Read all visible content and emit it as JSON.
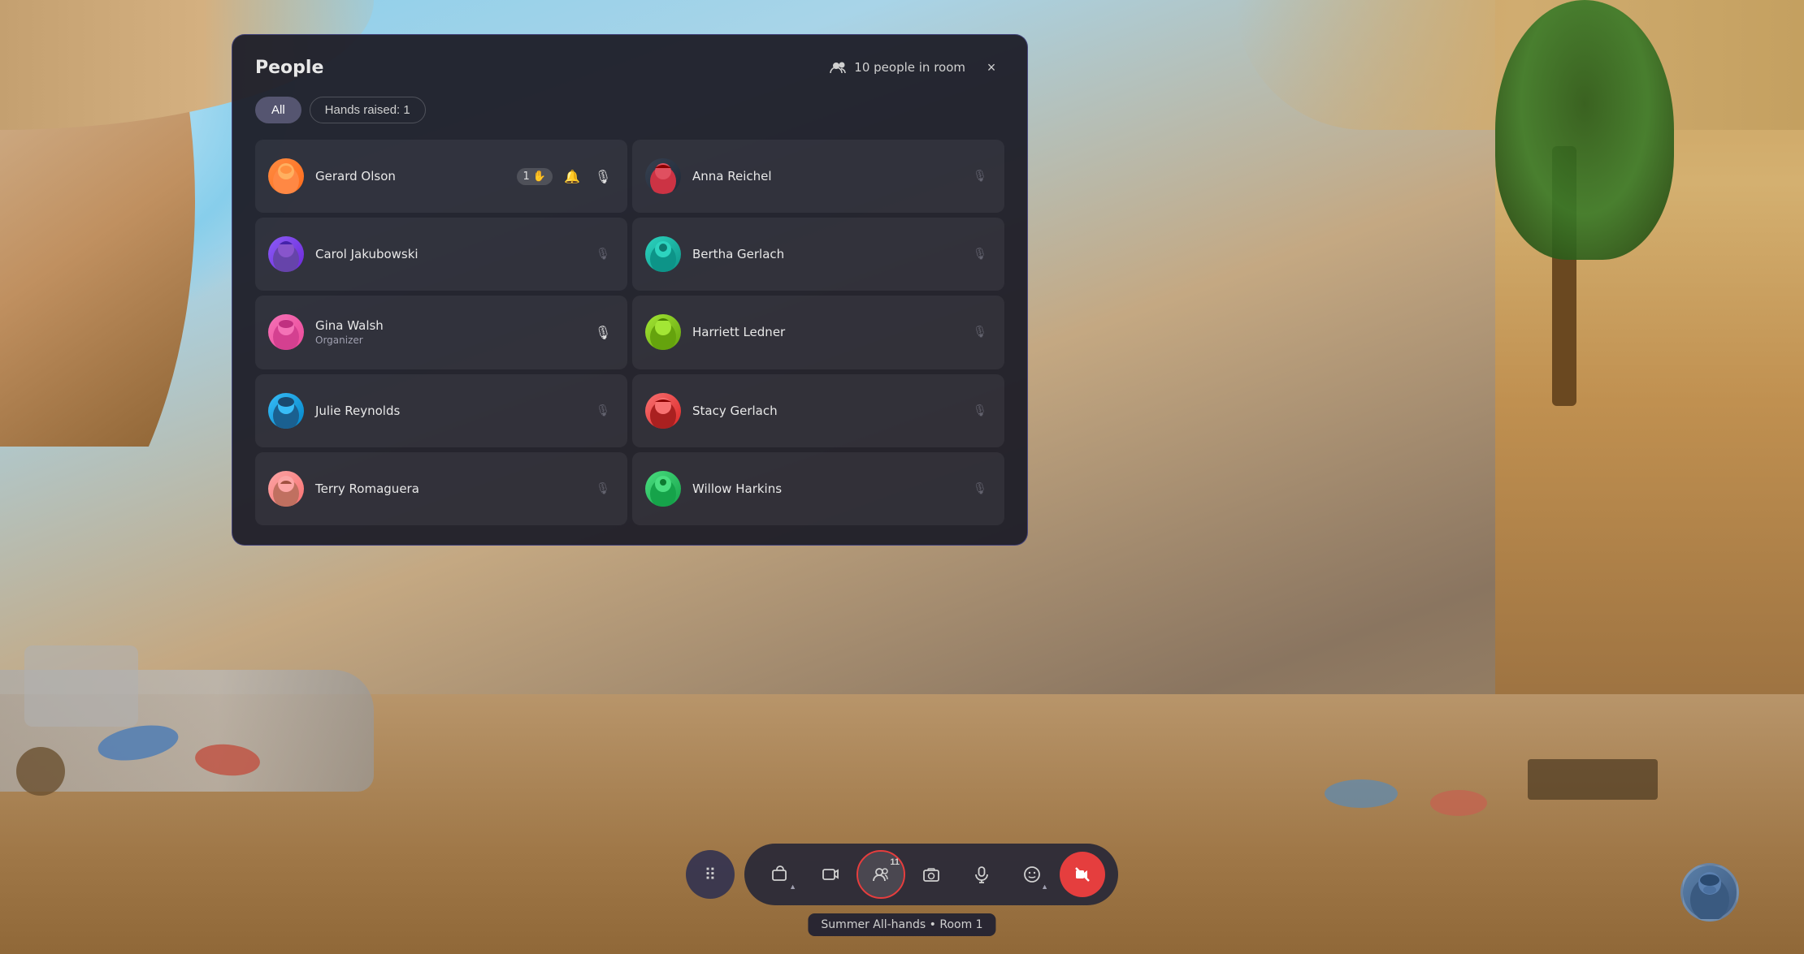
{
  "background": {
    "description": "3D virtual meeting room with organic architecture, sofa, cushions, tree"
  },
  "panel": {
    "title": "People",
    "people_count_label": "10 people in room",
    "close_label": "×",
    "filters": {
      "all_label": "All",
      "hands_raised_label": "Hands raised: 1"
    },
    "people": [
      {
        "name": "Gerard Olson",
        "role": "",
        "avatar_color": "av-orange",
        "avatar_emoji": "🧑",
        "hand_raised": true,
        "hand_count": "1",
        "has_bell": true,
        "mic_active": true,
        "muted": false
      },
      {
        "name": "Anna Reichel",
        "role": "",
        "avatar_color": "av-dark",
        "avatar_emoji": "👩",
        "hand_raised": false,
        "mic_active": false,
        "muted": true
      },
      {
        "name": "Carol Jakubowski",
        "role": "",
        "avatar_color": "av-purple",
        "avatar_emoji": "👩",
        "hand_raised": false,
        "mic_active": false,
        "muted": true
      },
      {
        "name": "Bertha Gerlach",
        "role": "",
        "avatar_color": "av-teal",
        "avatar_emoji": "👩",
        "hand_raised": false,
        "mic_active": false,
        "muted": true
      },
      {
        "name": "Gina Walsh",
        "role": "Organizer",
        "avatar_color": "av-pink",
        "avatar_emoji": "👩",
        "hand_raised": false,
        "mic_active": true,
        "muted": false
      },
      {
        "name": "Harriett Ledner",
        "role": "",
        "avatar_color": "av-lime",
        "avatar_emoji": "👩",
        "hand_raised": false,
        "mic_active": false,
        "muted": true
      },
      {
        "name": "Julie Reynolds",
        "role": "",
        "avatar_color": "av-blue",
        "avatar_emoji": "👩",
        "hand_raised": false,
        "mic_active": false,
        "muted": true
      },
      {
        "name": "Stacy Gerlach",
        "role": "",
        "avatar_color": "av-red",
        "avatar_emoji": "👩",
        "hand_raised": false,
        "mic_active": false,
        "muted": true
      },
      {
        "name": "Terry Romaguera",
        "role": "",
        "avatar_color": "av-peach",
        "avatar_emoji": "🧔",
        "hand_raised": false,
        "mic_active": false,
        "muted": true
      },
      {
        "name": "Willow Harkins",
        "role": "",
        "avatar_color": "av-green",
        "avatar_emoji": "👩",
        "hand_raised": false,
        "mic_active": false,
        "muted": true
      }
    ]
  },
  "toolbar": {
    "grid_btn_label": "⠿",
    "share_btn_label": "↑",
    "video_btn_label": "🎬",
    "people_btn_label": "👥",
    "people_count": "11",
    "camera_btn_label": "📷",
    "mic_btn_label": "🎙",
    "emoji_btn_label": "😊",
    "reactions_btn_label": "☎",
    "tooltip_label": "Summer All-hands • Room 1"
  },
  "bottom_avatar": {
    "emoji": "👩"
  }
}
